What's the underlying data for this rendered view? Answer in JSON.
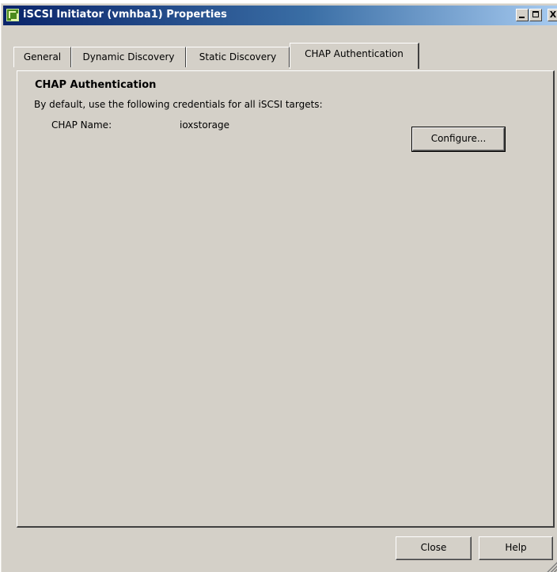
{
  "window": {
    "title": "iSCSI Initiator (vmhba1) Properties",
    "controls": {
      "minimize": "_",
      "maximize": "□",
      "close": "X"
    }
  },
  "tabs": [
    {
      "label": "General",
      "active": false
    },
    {
      "label": "Dynamic Discovery",
      "active": false
    },
    {
      "label": "Static Discovery",
      "active": false
    },
    {
      "label": "CHAP Authentication",
      "active": true
    }
  ],
  "chap": {
    "section_title": "CHAP Authentication",
    "description": "By default, use the following credentials for all iSCSI targets:",
    "name_label": "CHAP Name:",
    "name_value": "ioxstorage",
    "configure_label": "Configure..."
  },
  "footer": {
    "close_label": "Close",
    "help_label": "Help"
  },
  "colors": {
    "face": "#d4d0c8",
    "title_start": "#0a246a",
    "title_end": "#a6caf0",
    "icon_green": "#4b8a1d"
  },
  "icons": {
    "app": "vsphere-client-icon",
    "resize": "resize-grip-icon"
  }
}
